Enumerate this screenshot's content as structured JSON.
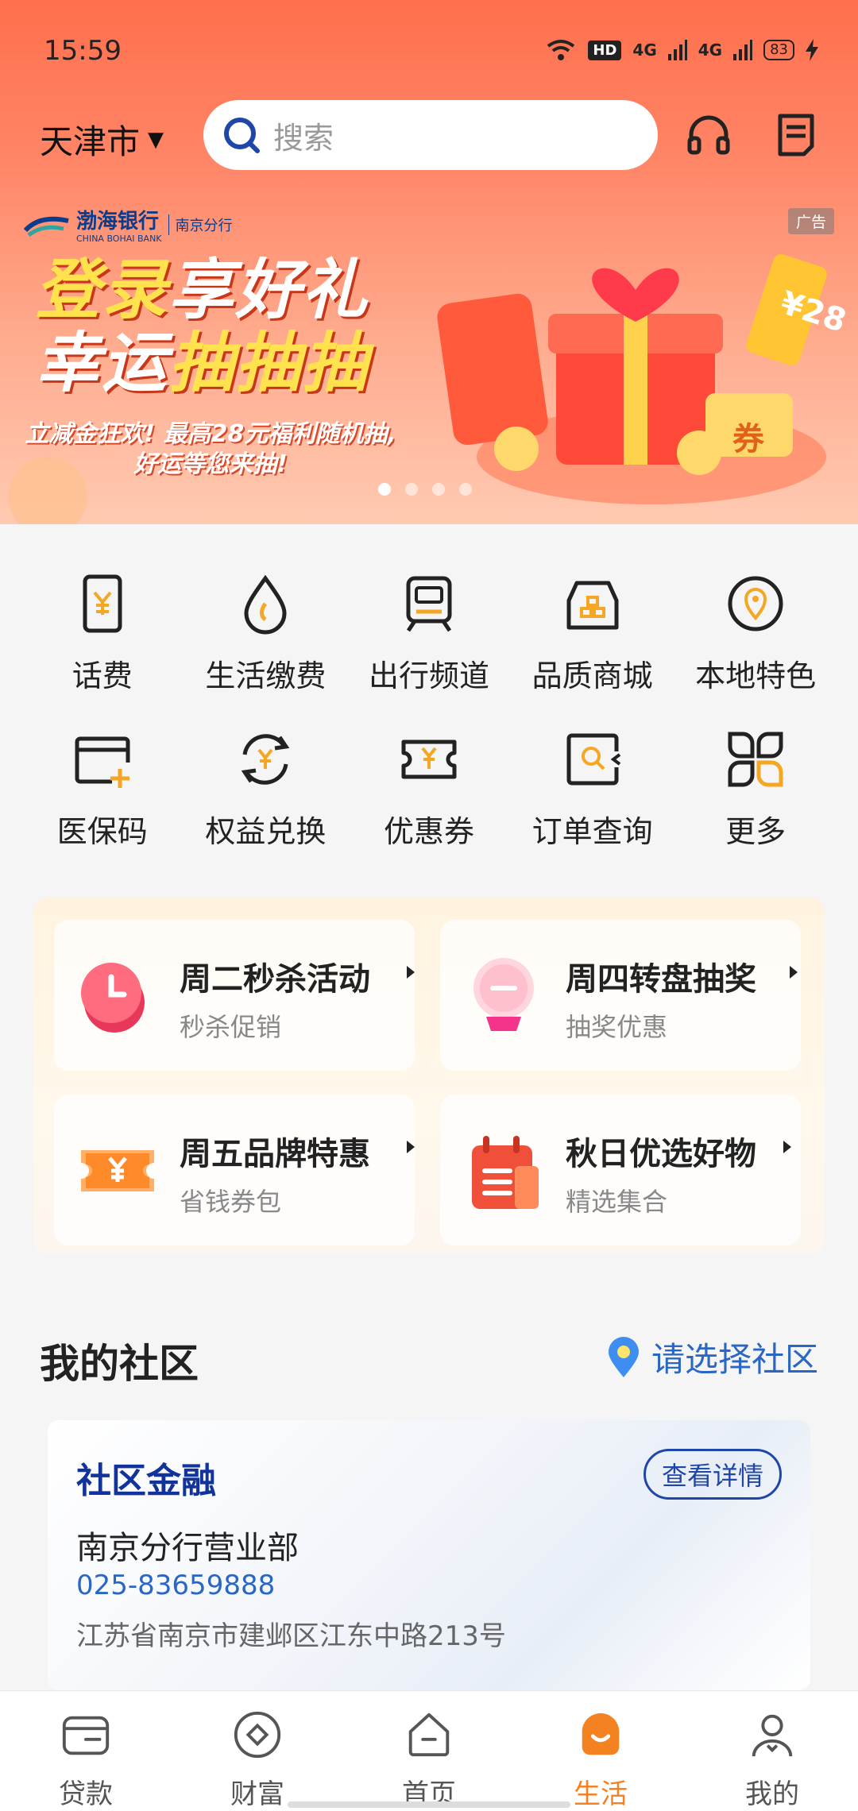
{
  "status_bar": {
    "time": "15:59",
    "hd": "HD",
    "net1": "4G",
    "net2": "4G",
    "battery": "83"
  },
  "header": {
    "city": "天津市",
    "search_placeholder": "搜索"
  },
  "banner": {
    "bank_name": "渤海银行",
    "bank_en": "CHINA BOHAI BANK",
    "branch": "南京分行",
    "ad_tag": "广告",
    "line1a": "登录",
    "line1b": "享好礼",
    "line2a": "幸运",
    "line2b": "抽抽抽",
    "sub1": "立减金狂欢! 最高28元福利随机抽,",
    "sub2": "好运等您来抽!",
    "coupon_text": "¥28",
    "coin_text": "券",
    "pages": 4,
    "current_page": 1
  },
  "services": [
    {
      "label": "话费",
      "icon": "phone-bill-icon"
    },
    {
      "label": "生活缴费",
      "icon": "utility-payment-icon"
    },
    {
      "label": "出行频道",
      "icon": "travel-icon"
    },
    {
      "label": "品质商城",
      "icon": "mall-icon"
    },
    {
      "label": "本地特色",
      "icon": "location-icon"
    },
    {
      "label": "医保码",
      "icon": "medical-card-icon"
    },
    {
      "label": "权益兑换",
      "icon": "exchange-icon"
    },
    {
      "label": "优惠券",
      "icon": "coupon-icon"
    },
    {
      "label": "订单查询",
      "icon": "order-search-icon"
    },
    {
      "label": "更多",
      "icon": "more-icon"
    }
  ],
  "promos": [
    {
      "title": "周二秒杀活动",
      "sub": "秒杀促销",
      "icon": "clock-icon"
    },
    {
      "title": "周四转盘抽奖",
      "sub": "抽奖优惠",
      "icon": "crystal-ball-icon"
    },
    {
      "title": "周五品牌特惠",
      "sub": "省钱券包",
      "icon": "ticket-icon"
    },
    {
      "title": "秋日优选好物",
      "sub": "精选集合",
      "icon": "calendar-icon"
    }
  ],
  "community": {
    "title": "我的社区",
    "pick": "请选择社区",
    "card_title": "社区金融",
    "detail_btn": "查看详情",
    "branch": "南京分行营业部",
    "phone": "025-83659888",
    "address": "江苏省南京市建邺区江东中路213号"
  },
  "nav": [
    {
      "label": "贷款",
      "icon": "wallet-icon"
    },
    {
      "label": "财富",
      "icon": "wealth-icon"
    },
    {
      "label": "首页",
      "icon": "home-icon"
    },
    {
      "label": "生活",
      "icon": "life-icon",
      "active": true
    },
    {
      "label": "我的",
      "icon": "profile-icon"
    }
  ],
  "colors": {
    "accent": "#f58220",
    "brand_blue": "#1f47a8",
    "link_blue": "#2a66c4",
    "header_orange": "#ff6f4d"
  }
}
